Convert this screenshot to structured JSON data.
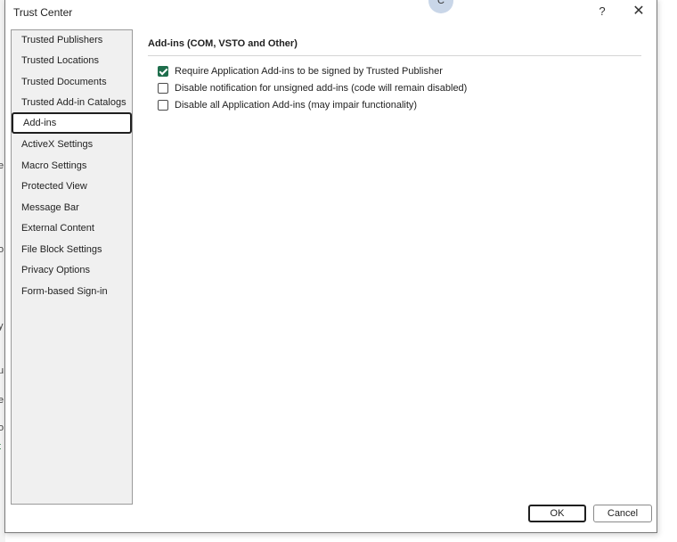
{
  "background_fragments": [
    "e",
    "o",
    "y",
    "u",
    "e",
    "o",
    "t"
  ],
  "dialog": {
    "title": "Trust Center",
    "avatar_initial": "C",
    "help_label": "?",
    "close_label": "✕"
  },
  "sidebar": {
    "items": [
      {
        "label": "Trusted Publishers"
      },
      {
        "label": "Trusted Locations"
      },
      {
        "label": "Trusted Documents"
      },
      {
        "label": "Trusted Add-in Catalogs"
      },
      {
        "label": "Add-ins",
        "selected": true
      },
      {
        "label": "ActiveX Settings"
      },
      {
        "label": "Macro Settings"
      },
      {
        "label": "Protected View"
      },
      {
        "label": "Message Bar"
      },
      {
        "label": "External Content"
      },
      {
        "label": "File Block Settings"
      },
      {
        "label": "Privacy Options"
      },
      {
        "label": "Form-based Sign-in"
      }
    ]
  },
  "main": {
    "section_title": "Add-ins (COM, VSTO and Other)",
    "options": [
      {
        "label": "Require Application Add-ins to be signed by Trusted Publisher",
        "checked": true
      },
      {
        "label": "Disable notification for unsigned add-ins (code will remain disabled)",
        "checked": false
      },
      {
        "label": "Disable all Application Add-ins (may impair functionality)",
        "checked": false
      }
    ]
  },
  "footer": {
    "ok_label": "OK",
    "cancel_label": "Cancel"
  },
  "colors": {
    "checkbox_checked": "#1e6e4c",
    "nav_background": "#f0f0f0",
    "background_green_text": "#1e7a3a"
  }
}
